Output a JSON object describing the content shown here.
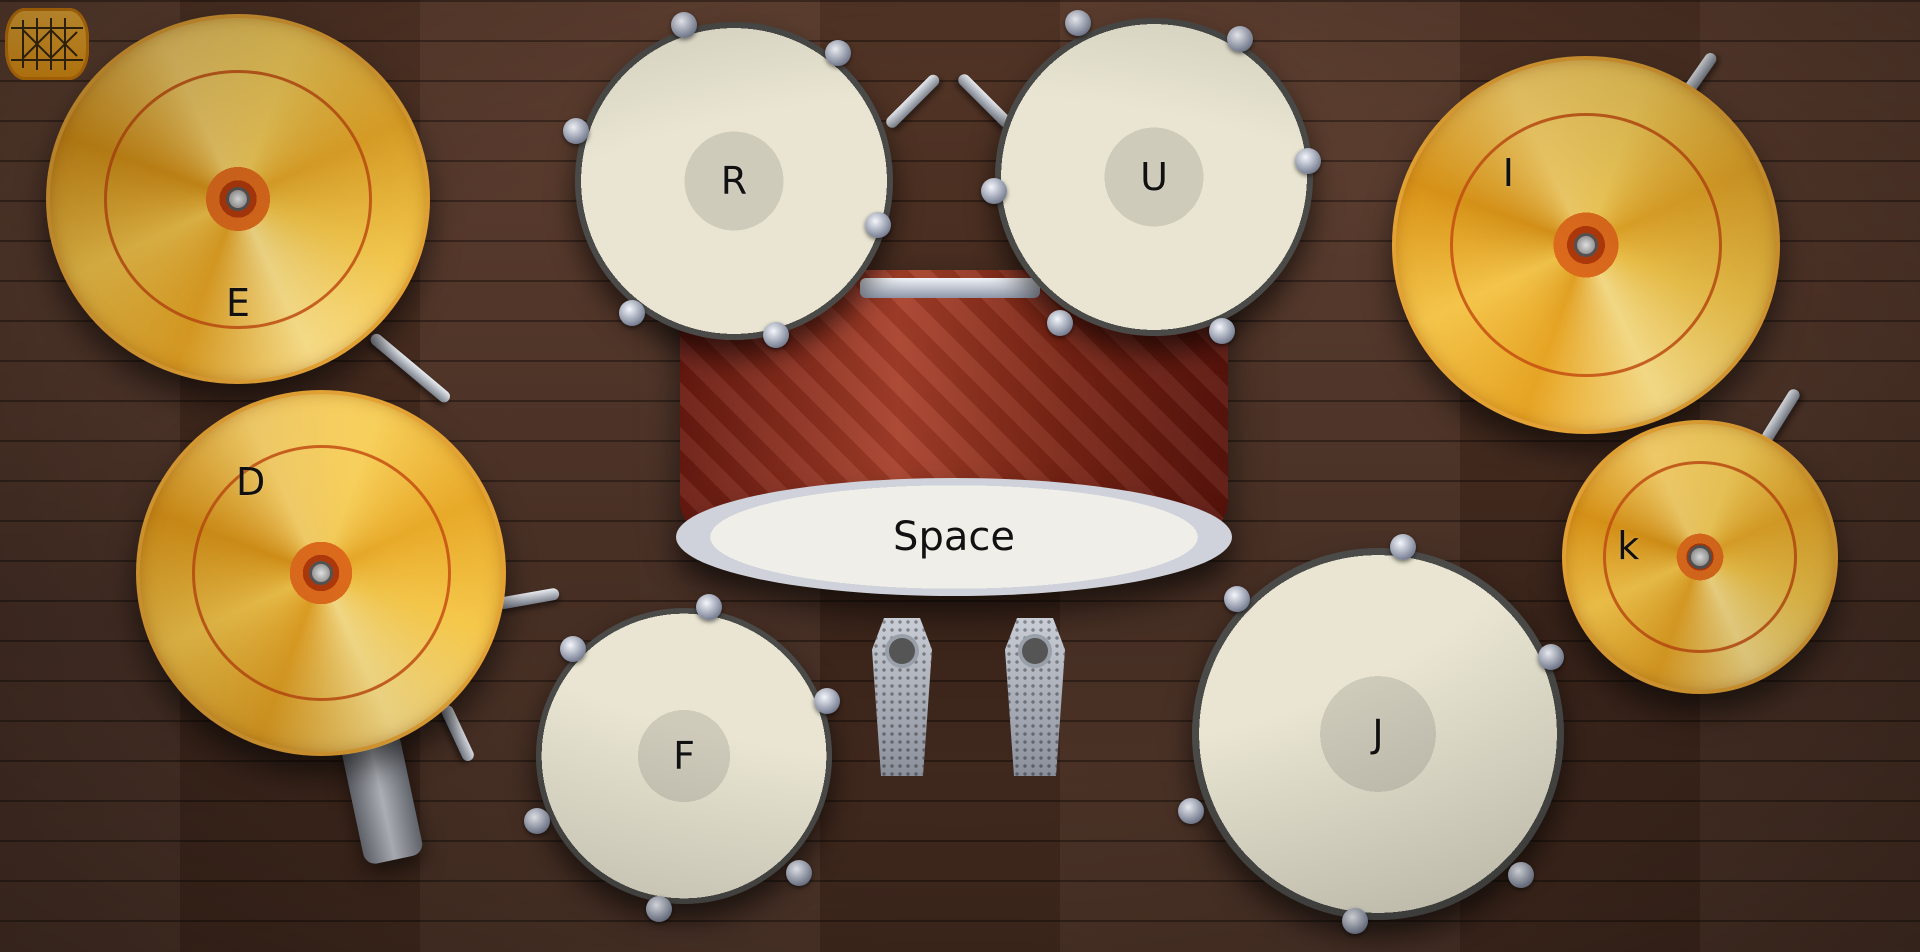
{
  "app": {
    "logo_icon": "drum-icon"
  },
  "pads": {
    "crash_left": {
      "key": "E"
    },
    "hihat_left": {
      "key": "D"
    },
    "tom_high_left": {
      "key": "R"
    },
    "tom_high_right": {
      "key": "U"
    },
    "ride_right": {
      "key": "I"
    },
    "splash_right": {
      "key": "k"
    },
    "bass_drum": {
      "key": "Space"
    },
    "floor_tom_left": {
      "key": "F"
    },
    "floor_tom_right": {
      "key": "J"
    }
  },
  "colors": {
    "cymbal": "#f2c14a",
    "cymbal_center": "#c04a12",
    "drum_head": "#e9e5d2",
    "shell": "#8a2a1a",
    "floor": "#4b2f22",
    "logo": "#f0a52a"
  }
}
